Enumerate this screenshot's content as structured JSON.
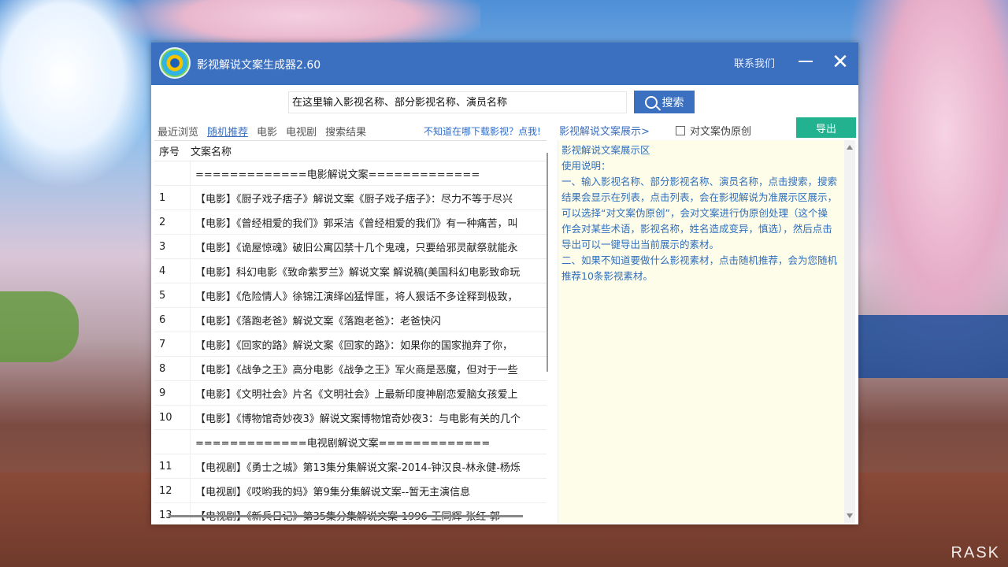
{
  "window": {
    "title": "影视解说文案生成器2.60",
    "contact_label": "联系我们",
    "close_glyph": "✕"
  },
  "search": {
    "placeholder": "在这里输入影视名称、部分影视名称、演员名称",
    "button_label": "搜索"
  },
  "tabs": [
    {
      "label": "最近浏览",
      "active": false
    },
    {
      "label": "随机推荐",
      "active": true
    },
    {
      "label": "电影",
      "active": false
    },
    {
      "label": "电视剧",
      "active": false
    },
    {
      "label": "搜索结果",
      "active": false
    }
  ],
  "download_link": "不知道在哪下载影视？点我!",
  "preview_label": "影视解说文案展示>",
  "pseudo_original_label": "对文案伪原创",
  "export_label": "导出",
  "table": {
    "headers": {
      "num": "序号",
      "name": "文案名称"
    },
    "rows": [
      {
        "num": "",
        "name": "=============电影解说文案============="
      },
      {
        "num": "1",
        "name": "【电影】《厨子戏子痞子》解说文案《厨子戏子痞子》：尽力不等于尽兴"
      },
      {
        "num": "2",
        "name": "【电影】《曾经相爱的我们》郭采洁《曾经相爱的我们》有一种痛苦，叫"
      },
      {
        "num": "3",
        "name": "【电影】《诡屋惊魂》破旧公寓囚禁十几个鬼魂，只要给邪灵献祭就能永"
      },
      {
        "num": "4",
        "name": "【电影】科幻电影《致命紫罗兰》解说文案 解说稿(美国科幻电影致命玩"
      },
      {
        "num": "5",
        "name": "【电影】《危险情人》徐锦江演绎凶猛悍匪，将人狠话不多诠释到极致，"
      },
      {
        "num": "6",
        "name": "【电影】《落跑老爸》解说文案《落跑老爸》：老爸快闪"
      },
      {
        "num": "7",
        "name": "【电影】《回家的路》解说文案《回家的路》：如果你的国家抛弃了你，"
      },
      {
        "num": "8",
        "name": "【电影】《战争之王》高分电影《战争之王》军火商是恶魔，但对于一些"
      },
      {
        "num": "9",
        "name": "【电影】《文明社会》片名《文明社会》上最新印度神剧恋爱脑女孩爱上"
      },
      {
        "num": "10",
        "name": "【电影】《博物馆奇妙夜3》解说文案博物馆奇妙夜3：与电影有关的几个"
      },
      {
        "num": "",
        "name": "=============电视剧解说文案============="
      },
      {
        "num": "11",
        "name": "【电视剧】《勇士之城》第13集分集解说文案-2014-钟汉良-林永健-杨烁"
      },
      {
        "num": "12",
        "name": "【电视剧】《哎哟我的妈》第9集分集解说文案--暂无主演信息"
      },
      {
        "num": "13",
        "name": "【电视剧】《新兵日记》第35集分集解说文案-1996-王同辉-张红-郭"
      }
    ]
  },
  "preview": {
    "lines": [
      "影视解说文案展示区",
      "使用说明：",
      "一、输入影视名称、部分影视名称、演员名称，点击搜索，搜索结果会显示在列表，点击列表，会在影视解说为准展示区展示，可以选择“对文案伪原创”，会对文案进行伪原创处理（这个操作会对某些术语，影视名称，姓名造成变异，慎选），然后点击导出可以一键导出当前展示的素材。",
      "二、如果不知道要做什么影视素材，点击随机推荐，会为您随机推荐10条影视素材。"
    ]
  },
  "watermark": "RASK",
  "colors": {
    "titlebar": "#3b6fc0",
    "export": "#23b28f",
    "preview_bg": "#fefde9",
    "preview_text": "#2f6fbd"
  }
}
